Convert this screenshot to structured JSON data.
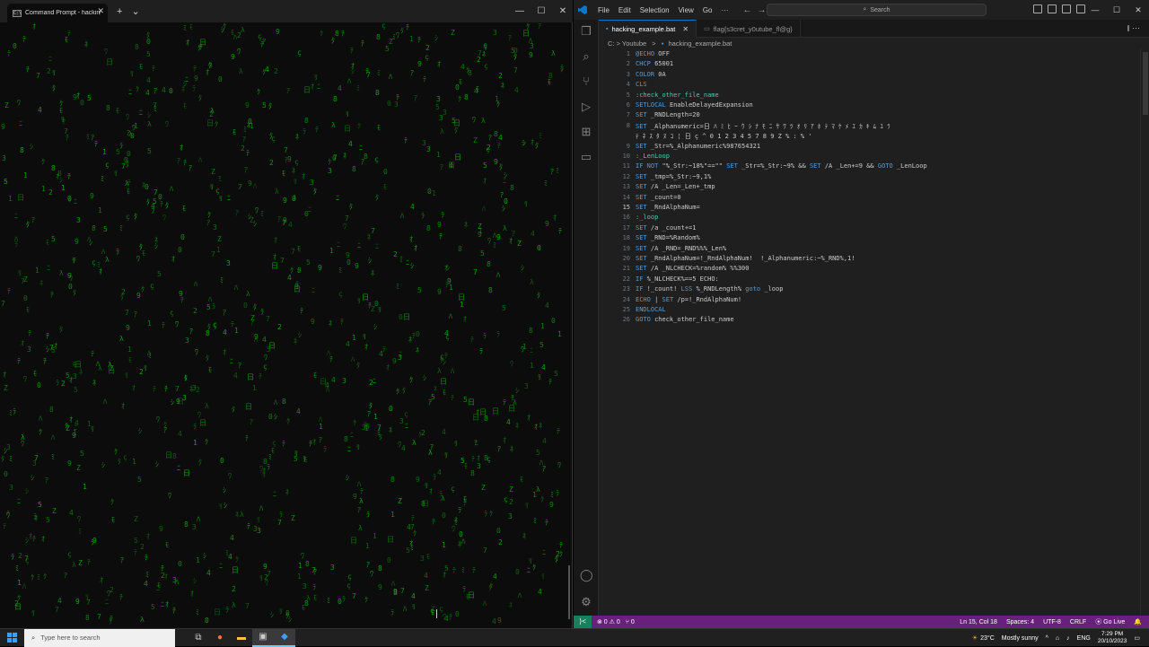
{
  "cmd": {
    "tab_title": "Command Prompt - hacking_e",
    "tab_icon": "C:\\",
    "new_tab": "+",
    "dropdown": "⌄",
    "minimize": "—",
    "maximize": "☐",
    "close": "✕",
    "matrix_color": "#13a10e",
    "matrix_glyphs": [
      "7",
      "3",
      "9",
      "8",
      "0",
      "1",
      "2",
      "4",
      "5",
      "Z",
      "ç",
      "λ",
      "ｸ",
      "ﾀ",
      "ﾃ",
      "ﾆ",
      "ﾊ",
      "ﾐ",
      "ｼ",
      "ﾓ",
      "ﾗ",
      "ﾜ",
      "日",
      "ｱ",
      "ﾈ",
      "ﾁ",
      "ｵ",
      "ﾘ"
    ]
  },
  "vscode": {
    "menu": [
      "File",
      "Edit",
      "Selection",
      "View",
      "Go",
      "···"
    ],
    "nav_back": "←",
    "nav_forward": "→",
    "search_placeholder": "Search",
    "search_icon": "⌕",
    "win_minimize": "—",
    "win_maximize": "☐",
    "win_close": "✕",
    "tabs": [
      {
        "label": "hacking_example.bat",
        "close": "✕"
      },
      {
        "label": "flag{s3cret_y0utube_fl@g}"
      }
    ],
    "tab_actions": "⫾   ···",
    "breadcrumb": {
      "folder_path": "C: > Youtube",
      "sep": ">",
      "file": "hacking_example.bat"
    },
    "current_line": 15,
    "lines": [
      "@ECHO OFF",
      "CHCP 65001",
      "COLOR 0A",
      "CLS",
      ":check_other_file_name",
      "SETLOCAL EnableDelayedExpansion",
      "SET _RNDLength=20",
      "SET _Alphanumeric=日 ﾊ ﾐ ﾋ ｰ ｳ ｼ ﾅ ﾓ ﾆ ｻ ﾜ ﾂ ｵ ﾘ ｱ ﾎ ﾃ ﾏ ｹ ﾒ ｴ ｶ ｷ ﾑ ﾕ ﾗ",
      "SET _Str=%_Alphanumeric%987654321",
      ":_LenLoop",
      "IF NOT \"%_Str:~18%\"==\"\" SET _Str=%_Str:~9% && SET /A _Len+=9 && GOTO _LenLoop",
      "SET _tmp=%_Str:~9,1%",
      "SET /A _Len=_Len+_tmp",
      "SET _count=0",
      "SET _RndAlphaNum=",
      ":_loop",
      "SET /a _count+=1",
      "SET _RND=%Random%",
      "SET /A _RND=_RND%%%_Len%",
      "SET _RndAlphaNum=!_RndAlphaNum!  !_Alphanumeric:~%_RND%,1!",
      "SET /A _NLCHECK=%random% %%300",
      "IF %_NLCHECK%==5 ECHO:",
      "IF !_count! LSS %_RNDLength% goto _loop",
      "ECHO | SET /p=!_RndAlphaNum!",
      "ENDLOCAL",
      "GOTO check_other_file_name"
    ],
    "line8_wrap": "ﾃ ﾈ ｽ ﾀ ﾇ ｺ ¦ 日 ç ^ 0 1 2 3 4 5 7 8 9 Z % : % '",
    "status": {
      "remote": "⟩<",
      "problems": "⊗ 0 ⚠ 0",
      "ports": "⑂ 0",
      "position": "Ln 15, Col 18",
      "spaces": "Spaces: 4",
      "encoding": "UTF-8",
      "eol": "CRLF",
      "golive": "⦿ Go Live",
      "bell": "🔔"
    },
    "accent": "#68217a"
  },
  "taskbar": {
    "search_placeholder": "Type here to search",
    "search_icon": "⌕",
    "weather": "23°C",
    "weather_desc": "Mostly sunny",
    "tray_arrow": "^",
    "lang": "ENG",
    "time": "7:29 PM",
    "date": "20/10/2023"
  }
}
